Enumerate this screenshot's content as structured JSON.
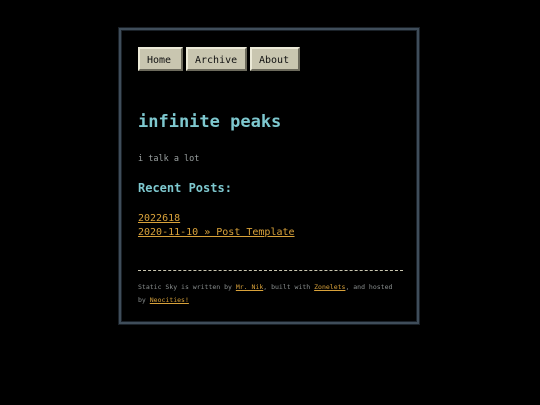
{
  "nav": {
    "items": [
      {
        "label": "Home"
      },
      {
        "label": "Archive"
      },
      {
        "label": "About"
      }
    ]
  },
  "header": {
    "title": "infinite peaks",
    "tagline": "i talk a lot"
  },
  "recent": {
    "heading": "Recent Posts:",
    "posts": [
      {
        "label": "2022618"
      },
      {
        "label": "2020-11-10 » Post Template"
      }
    ]
  },
  "footer": {
    "text1": "Static Sky is written by ",
    "author_link": "Mr. Nik",
    "text2": ", built with ",
    "builder_link": "Zonelets",
    "text3": ", and hosted by ",
    "host_link": "Neocities!"
  },
  "colors": {
    "accent": "#7ec8cf",
    "link": "#d9a23a",
    "button_face": "#c9c6b0",
    "frame_border": "#3f4d5a"
  }
}
